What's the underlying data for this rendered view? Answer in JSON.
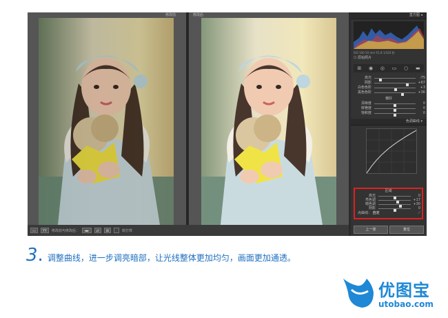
{
  "view": {
    "before_label": "修改前",
    "after_label": "修改后"
  },
  "toolbar": {
    "mode1": "▭",
    "mode2": "YY",
    "compare_label": "修改前与修改后：",
    "btn1": "◄►",
    "btn2": "⇄",
    "btn3": "⊞",
    "softproof_label": "软打样"
  },
  "histogram": {
    "title": "直方图",
    "readout": "ISO 100   50 mm   f/1.8   1/320 秒",
    "original_photo": "原始照片"
  },
  "basic": {
    "rows": [
      {
        "label": "高光",
        "value": "-75",
        "level": 0.15
      },
      {
        "label": "阴影",
        "value": "+67",
        "level": 0.8
      },
      {
        "label": "白色色阶",
        "value": "+3",
        "level": 0.52
      },
      {
        "label": "黑色色阶",
        "value": "+36",
        "level": 0.68
      }
    ],
    "presence_title": "偏好",
    "presence": [
      {
        "label": "清晰度",
        "value": "0",
        "level": 0.5
      },
      {
        "label": "鲜艳度",
        "value": "0",
        "level": 0.5
      },
      {
        "label": "饱和度",
        "value": "0",
        "level": 0.5
      }
    ]
  },
  "tonecurve": {
    "title": "色调曲线",
    "region_title": "区域",
    "rows": [
      {
        "label": "高光",
        "value": "0",
        "level": 0.5
      },
      {
        "label": "亮色调",
        "value": "+17",
        "level": 0.6
      },
      {
        "label": "暗色调",
        "value": "+30",
        "level": 0.68
      },
      {
        "label": "阴影",
        "value": "0",
        "level": 0.5
      }
    ],
    "channel_label": "点曲线：",
    "channel_value": "自定"
  },
  "nav": {
    "prev": "上一张",
    "reset": "复位"
  },
  "caption": {
    "number": "3",
    "dot": ".",
    "text": "调整曲线，进一步调亮暗部，让光线整体更加均匀，画面更加通透。"
  },
  "brand": {
    "name": "优图宝",
    "url": "utobao.com",
    "bird_color": "#1e88d6"
  }
}
